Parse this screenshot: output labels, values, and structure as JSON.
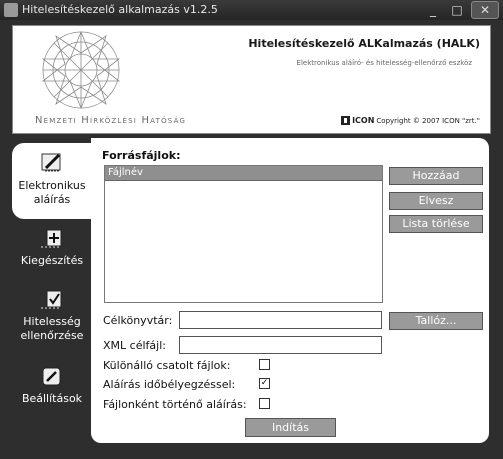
{
  "window": {
    "title": "Hitelesítéskezelő alkalmazás v1.2.5",
    "minimize_glyph": "_",
    "maximize_glyph": "□",
    "close_glyph": "✕"
  },
  "header": {
    "app_title": "Hitelesítéskezelő ALKalmazás (HALK)",
    "app_subtitle": "Elektronikus aláíró- és hitelesség-ellenőrző eszköz",
    "agency": "Nemzeti Hírközlési Hatóság",
    "brand": "ICON",
    "copyright": "Copyright © 2007 ICON \"zrt.\""
  },
  "sidebar": {
    "items": [
      {
        "label": "Elektronikus aláírás",
        "icon": "pen-sign-icon",
        "active": true
      },
      {
        "label": "Kiegészítés",
        "icon": "add-document-icon",
        "active": false
      },
      {
        "label": "Hitelesség ellenőrzése",
        "icon": "verify-check-icon",
        "active": false
      },
      {
        "label": "Beállítások",
        "icon": "settings-icon",
        "active": false
      }
    ]
  },
  "main": {
    "source_files_label": "Forrásfájlok:",
    "file_list_header": "Fájlnév",
    "add_button": "Hozzáad",
    "remove_button": "Elvesz",
    "clear_button": "Lista törlése",
    "target_dir_label": "Célkönyvtár:",
    "target_dir_value": "",
    "browse_button": "Tallóz...",
    "xml_label": "XML célfájl:",
    "xml_value": "",
    "detached_label": "Különálló csatolt fájlok:",
    "detached_checked": false,
    "timestamp_label": "Aláírás időbélyegzéssel:",
    "timestamp_checked": true,
    "per_file_label": "Fájlonként történő aláírás:",
    "per_file_checked": false,
    "start_button": "Indítás"
  }
}
